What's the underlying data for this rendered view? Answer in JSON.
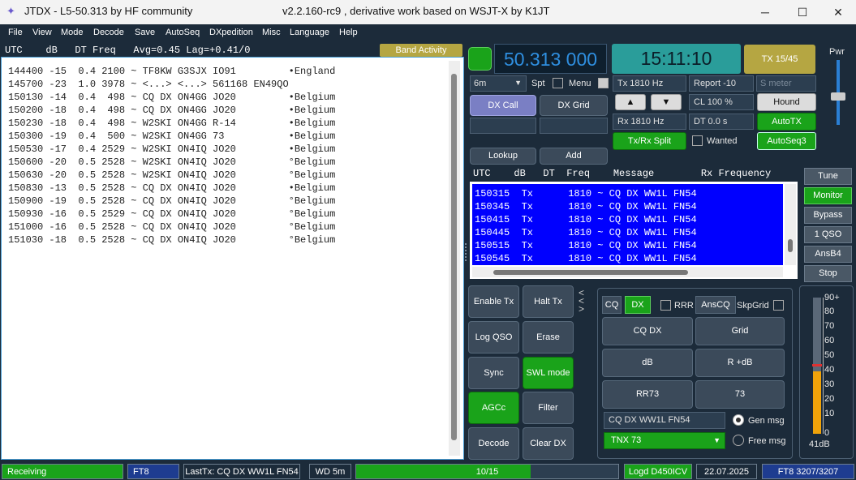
{
  "title": {
    "app": "JTDX - L5-50.313  by HF community",
    "version": "v2.2.160-rc9 , derivative work based on WSJT-X by K1JT",
    "minimize": "─",
    "maximize": "☐",
    "close": "✕"
  },
  "menu": [
    "File",
    "View",
    "Mode",
    "Decode",
    "Save",
    "AutoSeq",
    "DXpedition",
    "Misc",
    "Language",
    "Help"
  ],
  "band": {
    "header": "UTC    dB   DT Freq   Avg=0.45 Lag=+0.41/0",
    "button": "Band Activity",
    "lines": [
      "144400 -15  0.4 2100 ~ TF8KW G3SJX IO91         •England",
      "145700 -23  1.0 3978 ~ <...> <...> 561168 EN49QO",
      "150130 -14  0.4  498 ~ CQ DX ON4GG JO20         •Belgium",
      "150200 -18  0.4  498 ~ CQ DX ON4GG JO20         •Belgium",
      "150230 -18  0.4  498 ~ W2SKI ON4GG R-14         •Belgium",
      "150300 -19  0.4  500 ~ W2SKI ON4GG 73           •Belgium",
      "150530 -17  0.4 2529 ~ W2SKI ON4IQ JO20         •Belgium",
      "150600 -20  0.5 2528 ~ W2SKI ON4IQ JO20         °Belgium",
      "150630 -20  0.5 2528 ~ W2SKI ON4IQ JO20         °Belgium",
      "150830 -13  0.5 2528 ~ CQ DX ON4IQ JO20         •Belgium",
      "150900 -19  0.5 2528 ~ CQ DX ON4IQ JO20         °Belgium",
      "150930 -16  0.5 2529 ~ CQ DX ON4IQ JO20         °Belgium",
      "151000 -16  0.5 2528 ~ CQ DX ON4IQ JO20         °Belgium",
      "151030 -18  0.5 2528 ~ CQ DX ON4IQ JO20         °Belgium"
    ]
  },
  "top": {
    "frequency": "50.313 000",
    "clock": "15:11:10",
    "tx_period": "TX 15/45",
    "pwr": "Pwr"
  },
  "controls": {
    "band": "6m",
    "spt": "Spt",
    "menu": "Menu",
    "tx_hz": "Tx  1810  Hz",
    "rx_hz": "Rx  1810  Hz",
    "report": "Report -10",
    "smeter": "S meter",
    "cl": "CL  100 %",
    "dt": "DT 0.0 s",
    "hound": "Hound",
    "autotx": "AutoTX",
    "autoseq": "AutoSeq3",
    "dxcall": "DX Call",
    "dxgrid": "DX Grid",
    "txrx_split": "Tx/Rx Split",
    "wanted": "Wanted",
    "lookup": "Lookup",
    "add": "Add",
    "up": "▲",
    "down": "▼"
  },
  "msg": {
    "header": "UTC    dB   DT  Freq    Message        Rx Frequency",
    "lines": [
      "150315  Tx      1810 ~ CQ DX WW1L FN54",
      "150345  Tx      1810 ~ CQ DX WW1L FN54",
      "150415  Tx      1810 ~ CQ DX WW1L FN54",
      "150445  Tx      1810 ~ CQ DX WW1L FN54",
      "150515  Tx      1810 ~ CQ DX WW1L FN54",
      "150545  Tx      1810 ~ CQ DX WW1L FN54"
    ]
  },
  "right_buttons": [
    "Tune",
    "Monitor",
    "Bypass",
    "1 QSO",
    "AnsB4",
    "Stop"
  ],
  "left_buttons": {
    "enable_tx": "Enable Tx",
    "halt_tx": "Halt Tx",
    "log_qso": "Log QSO",
    "erase": "Erase",
    "sync": "Sync",
    "swl": "SWL mode",
    "agcc": "AGCc",
    "filter": "Filter",
    "decode": "Decode",
    "clear_dx": "Clear DX"
  },
  "tx_panel": {
    "cq": "CQ",
    "dx": "DX",
    "rrr": "RRR",
    "anscq": "AnsCQ",
    "skpgrid": "SkpGrid",
    "cqdx": "CQ DX",
    "grid": "Grid",
    "db": "dB",
    "rdb": "R +dB",
    "rr73": "RR73",
    "b73": "73",
    "genmsg_text": "CQ DX WW1L FN54",
    "gen_msg": "Gen msg",
    "tnx": "TNX 73",
    "free_msg": "Free msg"
  },
  "meter": {
    "scale": [
      "90+",
      "80",
      "70",
      "60",
      "50",
      "40",
      "30",
      "20",
      "10",
      "0"
    ],
    "value_label": "41dB",
    "level_db": 41
  },
  "status": {
    "receiving": "Receiving",
    "mode": "FT8",
    "lasttx": "LastTx: CQ DX WW1L FN54",
    "wd": "WD 5m",
    "progress": "10/15",
    "progress_fraction": 0.667,
    "logd": "Logd D450ICV",
    "date": "22.07.2025",
    "decodes": "FT8  3207/3207"
  },
  "colors": {
    "bg": "#1c2b3a",
    "green": "#1aa31a",
    "teal": "#2a9d9a",
    "blue": "#0000ff",
    "gold": "#b5a642"
  }
}
